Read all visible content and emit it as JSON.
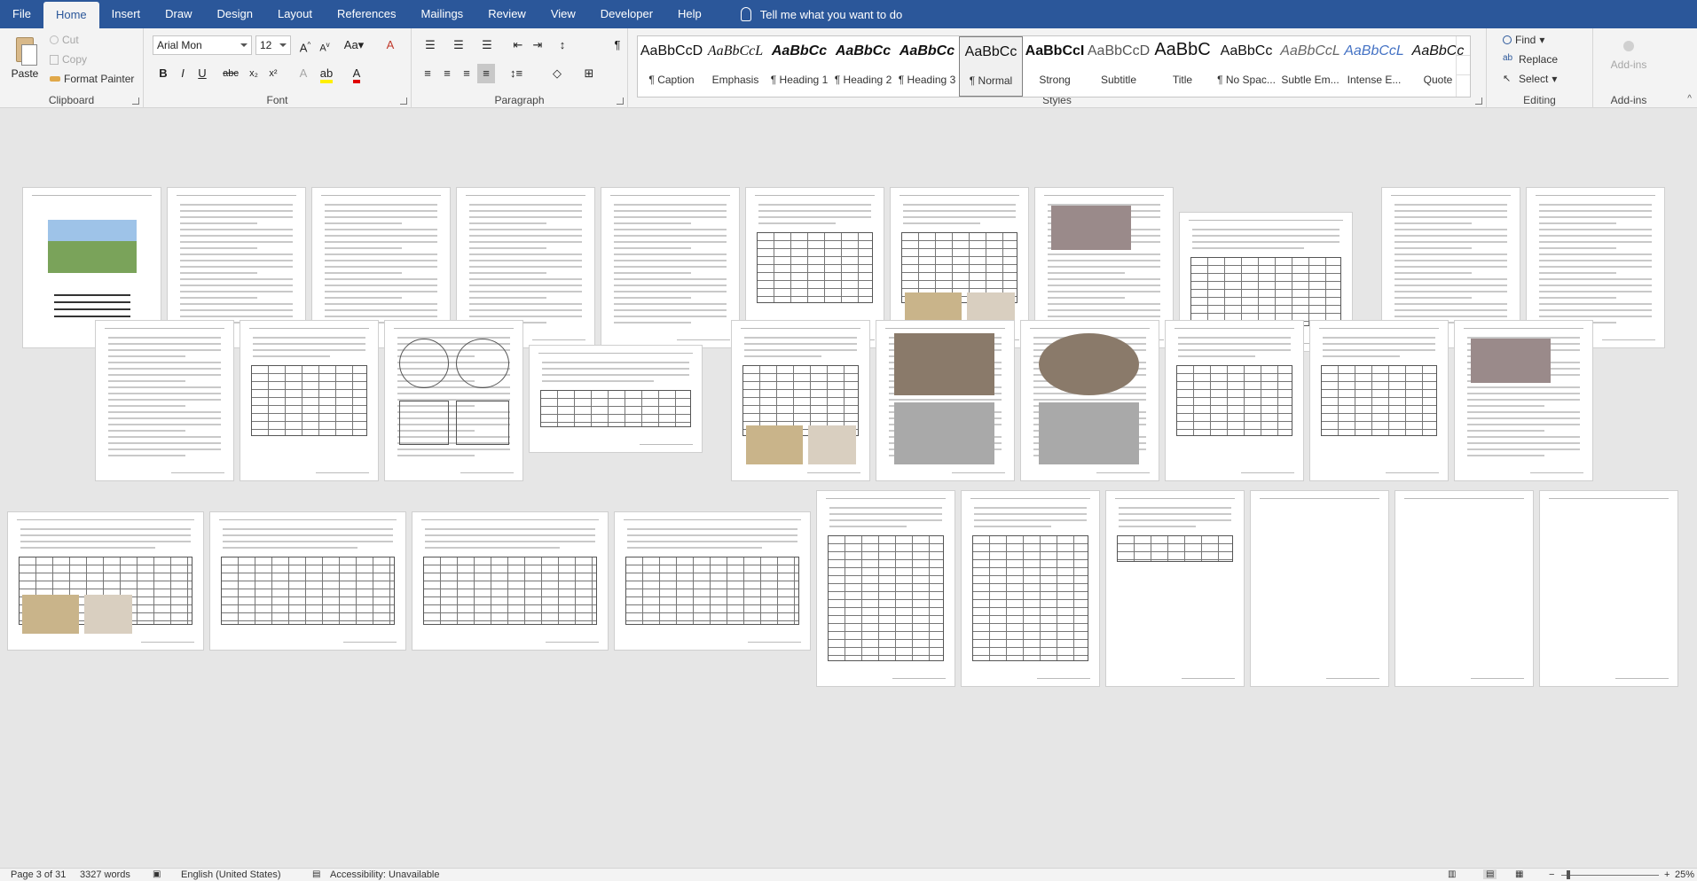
{
  "tabs": [
    "File",
    "Home",
    "Insert",
    "Draw",
    "Design",
    "Layout",
    "References",
    "Mailings",
    "Review",
    "View",
    "Developer",
    "Help"
  ],
  "active_tab": "Home",
  "tell_me": "Tell me what you want to do",
  "clipboard": {
    "label": "Clipboard",
    "paste": "Paste",
    "cut": "Cut",
    "copy": "Copy",
    "format_painter": "Format Painter"
  },
  "font": {
    "label": "Font",
    "name": "Arial Mon",
    "size": "12"
  },
  "paragraph": {
    "label": "Paragraph"
  },
  "styles": {
    "label": "Styles",
    "items": [
      {
        "sample": "AaBbCcD",
        "name": "¶ Caption"
      },
      {
        "sample": "AaBbCcL",
        "name": "Emphasis"
      },
      {
        "sample": "AaBbCc",
        "name": "¶ Heading 1"
      },
      {
        "sample": "AaBbCc",
        "name": "¶ Heading 2"
      },
      {
        "sample": "AaBbCc",
        "name": "¶ Heading 3"
      },
      {
        "sample": "AaBbCc",
        "name": "¶ Normal"
      },
      {
        "sample": "AaBbCcI",
        "name": "Strong"
      },
      {
        "sample": "AaBbCcD",
        "name": "Subtitle"
      },
      {
        "sample": "AaBbC",
        "name": "Title"
      },
      {
        "sample": "AaBbCc",
        "name": "¶ No Spac..."
      },
      {
        "sample": "AaBbCcL",
        "name": "Subtle Em..."
      },
      {
        "sample": "AaBbCcL",
        "name": "Intense E..."
      },
      {
        "sample": "AaBbCc",
        "name": "Quote"
      }
    ],
    "selected_index": 5
  },
  "editing": {
    "label": "Editing",
    "find": "Find",
    "replace": "Replace",
    "select": "Select"
  },
  "addins": {
    "label": "Add-ins",
    "button": "Add-ins"
  },
  "status": {
    "page": "Page 3 of 31",
    "words": "3327 words",
    "language": "English (United States)",
    "accessibility": "Accessibility: Unavailable",
    "zoom": "25%"
  },
  "colors": {
    "tabbar": "#2b579a",
    "ribbon": "#f3f3f3",
    "docarea": "#e6e6e6"
  }
}
